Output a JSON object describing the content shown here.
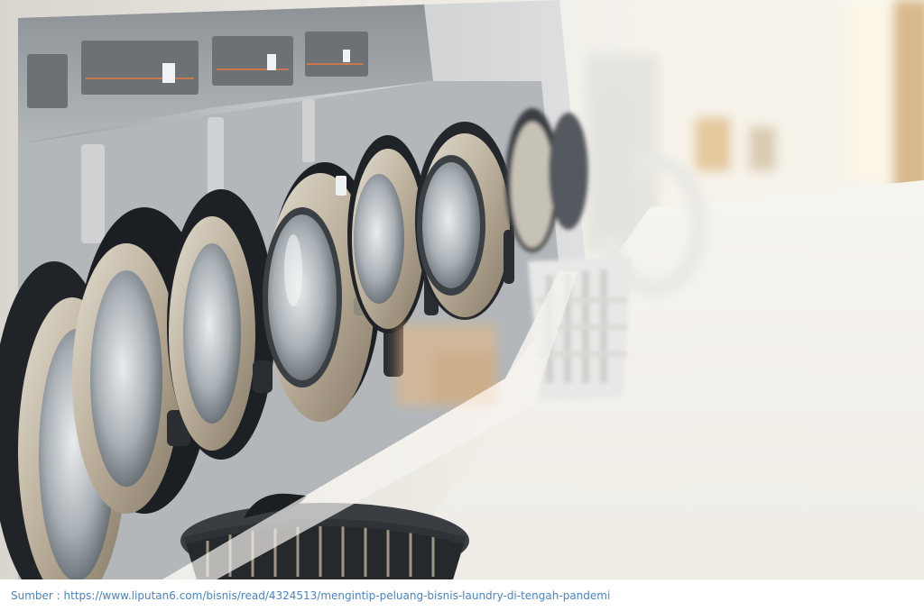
{
  "photo": {
    "subject": "laundromat-washing-machines"
  },
  "caption": {
    "text": "Sumber : https://www.liputan6.com/bisnis/read/4324513/mengintip-peluang-bisnis-laundry-di-tengah-pandemi"
  },
  "colors": {
    "caption_text": "#4a83c6",
    "floor": "#f3f2ef",
    "machine_steel": "#b9bcbf",
    "gasket": "#1f2226",
    "door_ring": "#c9c2b4"
  }
}
